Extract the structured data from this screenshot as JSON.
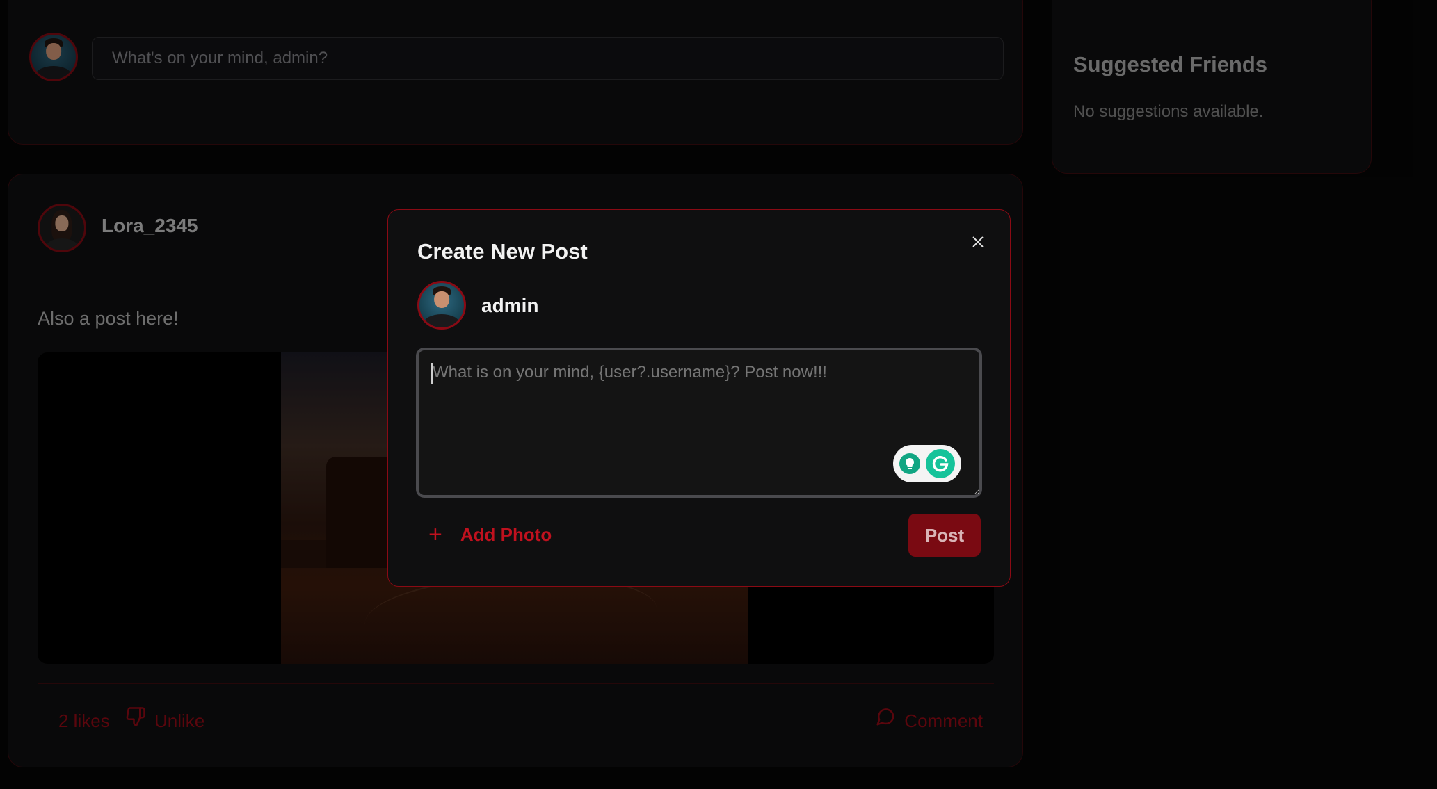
{
  "composer": {
    "placeholder": "What's on your mind, admin?"
  },
  "post": {
    "username": "Lora_2345",
    "text": "Also a post here!",
    "likes_label": "2 likes",
    "unlike_label": "Unlike",
    "comment_label": "Comment"
  },
  "sidebar": {
    "title": "Suggested Friends",
    "empty_text": "No suggestions available."
  },
  "modal": {
    "title": "Create New Post",
    "username": "admin",
    "textarea_placeholder": "What is on your mind, {user?.username}? Post now!!!",
    "add_photo_label": "Add Photo",
    "add_photo_icon": "+",
    "post_label": "Post"
  },
  "colors": {
    "accent": "#8a0a14",
    "button": "#7a0a12",
    "background": "#060606",
    "card": "#0f0f10"
  },
  "icons": {
    "close": "close-icon",
    "thumbs_down": "thumbs-down-icon",
    "comment": "comment-bubble-icon",
    "plus": "plus-icon",
    "grammarly": "grammarly-icon"
  }
}
